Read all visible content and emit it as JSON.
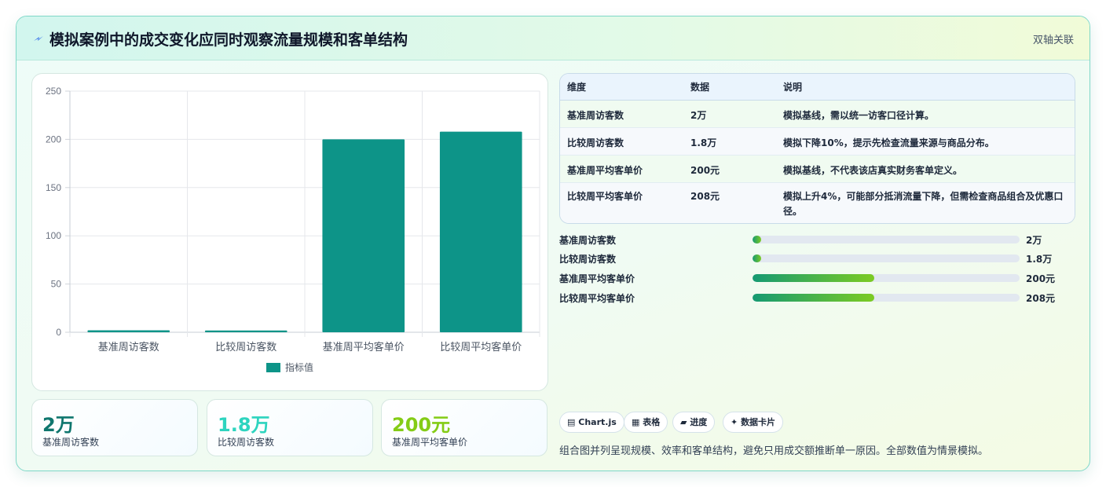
{
  "header": {
    "title": "模拟案例中的成交变化应同时观察流量规模和客单结构",
    "badge": "双轴关联",
    "icon": "lightning-icon"
  },
  "chart_data": {
    "type": "bar",
    "categories": [
      "基准周访客数",
      "比较周访客数",
      "基准周平均客单价",
      "比较周平均客单价"
    ],
    "series": [
      {
        "name": "指标值",
        "values": [
          2,
          1.8,
          200,
          208
        ]
      }
    ],
    "ylim": [
      0,
      250
    ],
    "yticks": [
      0,
      50,
      100,
      150,
      200,
      250
    ],
    "grid": true,
    "legend": "bottom",
    "color": "#0d9488"
  },
  "stats": [
    {
      "value": "2万",
      "label": "基准周访客数",
      "color": "#0f766e"
    },
    {
      "value": "1.8万",
      "label": "比较周访客数",
      "color": "#2dd4bf"
    },
    {
      "value": "200元",
      "label": "基准周平均客单价",
      "color": "#84cc16"
    }
  ],
  "table": {
    "headers": [
      "维度",
      "数据",
      "说明"
    ],
    "rows": [
      [
        "基准周访客数",
        "2万",
        "模拟基线，需以统一访客口径计算。"
      ],
      [
        "比较周访客数",
        "1.8万",
        "模拟下降10%，提示先检查流量来源与商品分布。"
      ],
      [
        "基准周平均客单价",
        "200元",
        "模拟基线，不代表该店真实财务客单定义。"
      ],
      [
        "比较周平均客单价",
        "208元",
        "模拟上升4%，可能部分抵消流量下降，但需检查商品组合及优惠口径。"
      ]
    ]
  },
  "progress": [
    {
      "label": "基准周访客数",
      "value": "2万",
      "fraction": 0.032
    },
    {
      "label": "比较周访客数",
      "value": "1.8万",
      "fraction": 0.032
    },
    {
      "label": "基准周平均客单价",
      "value": "200元",
      "fraction": 0.455
    },
    {
      "label": "比较周平均客单价",
      "value": "208元",
      "fraction": 0.455
    }
  ],
  "chips": [
    {
      "icon": "chart-icon",
      "glyph": "▤",
      "label": "Chart.js"
    },
    {
      "icon": "table-icon",
      "glyph": "▦",
      "label": "表格"
    },
    {
      "icon": "progress-icon",
      "glyph": "▰",
      "label": "进度"
    },
    {
      "icon": "sparkle-icon",
      "glyph": "✦",
      "label": "数据卡片"
    }
  ],
  "footnote": "组合图并列呈现规模、效率和客单结构，避免只用成交额推断单一原因。全部数值为情景模拟。"
}
